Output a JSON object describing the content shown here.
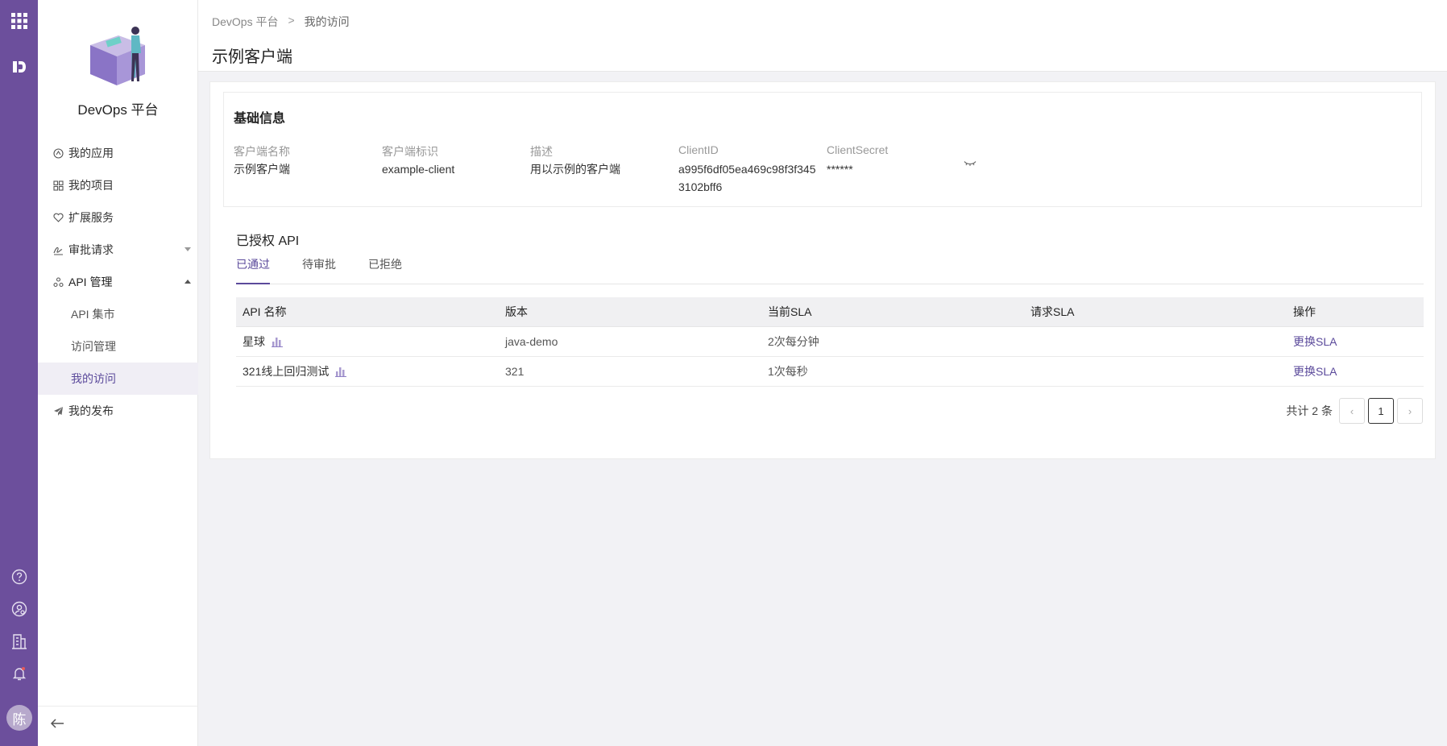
{
  "sidebar": {
    "brand": "DevOps 平台",
    "items": [
      {
        "label": "我的应用"
      },
      {
        "label": "我的项目"
      },
      {
        "label": "扩展服务"
      },
      {
        "label": "审批请求"
      },
      {
        "label": "API 管理"
      }
    ],
    "sub_items": [
      {
        "label": "API 集市"
      },
      {
        "label": "访问管理"
      },
      {
        "label": "我的访问"
      }
    ],
    "last_item": {
      "label": "我的发布"
    }
  },
  "rail": {
    "avatar_text": "陈",
    "icons": [
      "apps-grid-icon",
      "brand-logo-icon",
      "help-icon",
      "user-settings-icon",
      "building-icon",
      "bell-icon"
    ]
  },
  "header": {
    "breadcrumb": [
      "DevOps 平台",
      "我的访问"
    ],
    "separator": ">",
    "title": "示例客户端"
  },
  "info": {
    "title": "基础信息",
    "fields": [
      {
        "label": "客户端名称",
        "value": "示例客户端"
      },
      {
        "label": "客户端标识",
        "value": "example-client"
      },
      {
        "label": "描述",
        "value": "用以示例的客户端"
      },
      {
        "label": "ClientID",
        "value": "a995f6df05ea469c98f3f3453102bff6"
      },
      {
        "label": "ClientSecret",
        "value": "******"
      }
    ]
  },
  "apis": {
    "title": "已授权 API",
    "tabs": [
      {
        "label": "已通过",
        "active": true
      },
      {
        "label": "待审批",
        "active": false
      },
      {
        "label": "已拒绝",
        "active": false
      }
    ],
    "columns": [
      "API 名称",
      "版本",
      "当前SLA",
      "请求SLA",
      "操作"
    ],
    "rows": [
      {
        "name": "星球",
        "version": "java-demo",
        "current_sla": "2次每分钟",
        "requested_sla": "",
        "action": "更换SLA"
      },
      {
        "name": "321线上回归测试",
        "version": "321",
        "current_sla": "1次每秒",
        "requested_sla": "",
        "action": "更换SLA"
      }
    ],
    "pagination": {
      "total_text": "共计 2 条",
      "current_page": "1",
      "prev": "‹",
      "next": "›"
    }
  },
  "colors": {
    "rail": "#6c4f9c",
    "accent": "#5b4a9b",
    "page_bg": "#f2f2f5"
  }
}
